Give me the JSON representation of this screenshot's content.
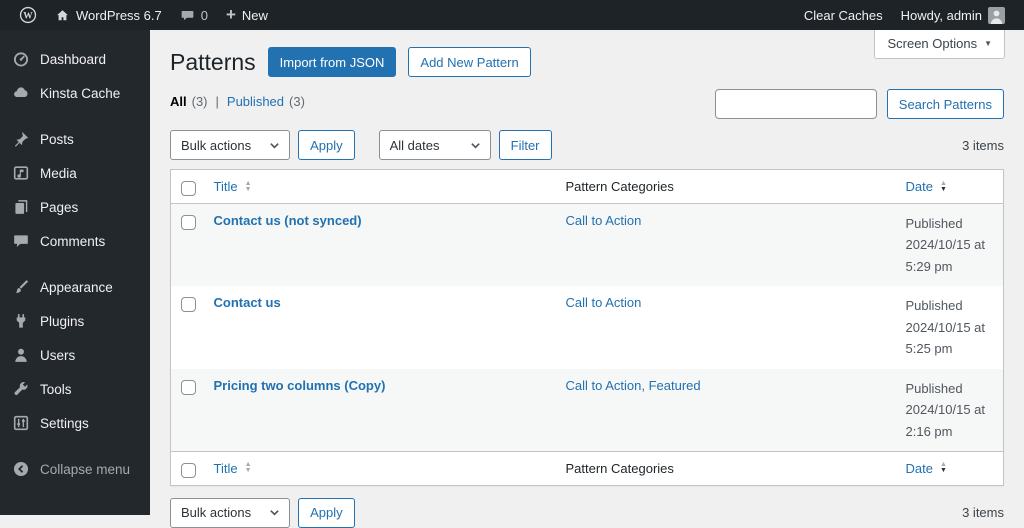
{
  "admin_bar": {
    "site_name": "WordPress 6.7",
    "comments_count": "0",
    "new_label": "New",
    "clear_caches_label": "Clear Caches",
    "howdy": "Howdy, admin"
  },
  "sidebar": {
    "items": [
      {
        "label": "Dashboard",
        "icon": "dashboard-icon"
      },
      {
        "label": "Kinsta Cache",
        "icon": "cloud-icon"
      },
      {
        "label": "Posts",
        "icon": "pushpin-icon"
      },
      {
        "label": "Media",
        "icon": "media-icon"
      },
      {
        "label": "Pages",
        "icon": "pages-icon"
      },
      {
        "label": "Comments",
        "icon": "comment-icon"
      },
      {
        "label": "Appearance",
        "icon": "brush-icon"
      },
      {
        "label": "Plugins",
        "icon": "plug-icon"
      },
      {
        "label": "Users",
        "icon": "user-icon"
      },
      {
        "label": "Tools",
        "icon": "wrench-icon"
      },
      {
        "label": "Settings",
        "icon": "sliders-icon"
      },
      {
        "label": "Collapse menu",
        "icon": "collapse-arrow-icon"
      }
    ]
  },
  "page": {
    "title": "Patterns",
    "import_button": "Import from JSON",
    "add_button": "Add New Pattern",
    "screen_options": "Screen Options"
  },
  "views": {
    "all": "All",
    "all_count": "(3)",
    "sep": "|",
    "published": "Published",
    "published_count": "(3)"
  },
  "search": {
    "value": "",
    "button": "Search Patterns"
  },
  "tablenav": {
    "bulk_actions": "Bulk actions",
    "apply": "Apply",
    "all_dates": "All dates",
    "filter": "Filter",
    "items_count": "3 items"
  },
  "table": {
    "headers": {
      "title": "Title",
      "categories": "Pattern Categories",
      "date": "Date"
    },
    "rows": [
      {
        "title": "Contact us (not synced)",
        "categories": "Call to Action",
        "status": "Published",
        "date": "2024/10/15 at",
        "time": "5:29 pm"
      },
      {
        "title": "Contact us",
        "categories": "Call to Action",
        "status": "Published",
        "date": "2024/10/15 at",
        "time": "5:25 pm"
      },
      {
        "title": "Pricing two columns (Copy)",
        "categories": "Call to Action, Featured",
        "status": "Published",
        "date": "2024/10/15 at",
        "time": "2:16 pm"
      }
    ]
  },
  "icons": {
    "dropdown_arrow": "▼",
    "sort_asc": "▲",
    "sort_desc": "▼",
    "plus": "+"
  },
  "colors": {
    "accent": "#2271b1",
    "admin_bar_bg": "#1d2327",
    "sidebar_bg": "#23282d",
    "content_bg": "#f0f0f1",
    "row_stripe": "#f6f7f7",
    "table_border": "#c3c4c7"
  }
}
